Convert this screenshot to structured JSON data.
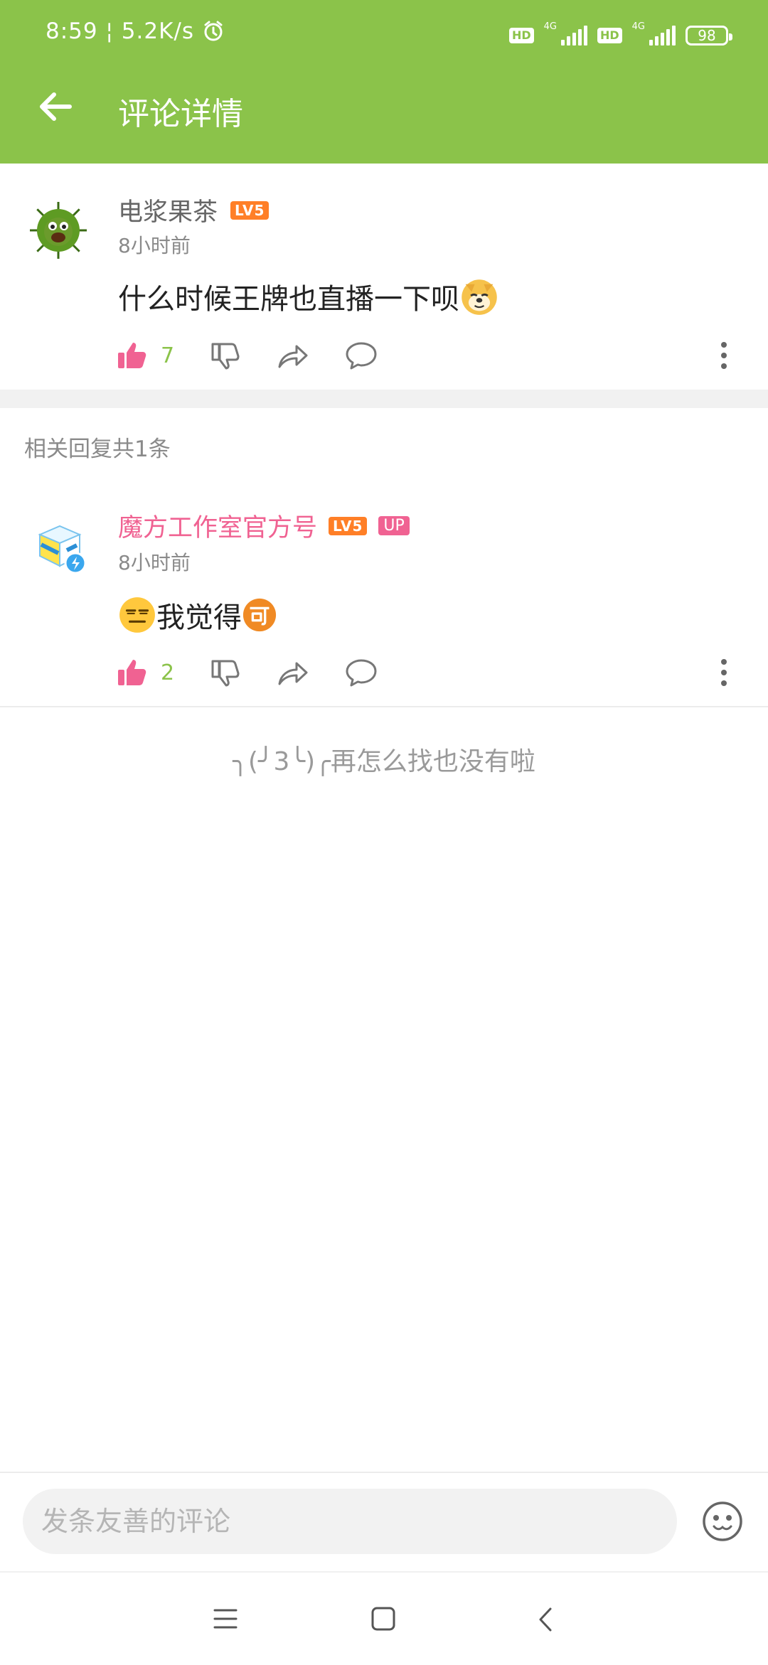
{
  "status_bar": {
    "time": "8:59",
    "speed": "5.2K/s",
    "hd": "HD",
    "network": "4G",
    "battery": "98"
  },
  "app_bar": {
    "title": "评论详情"
  },
  "main_comment": {
    "username": "电浆果茶",
    "level": "LV5",
    "time": "8小时前",
    "text": "什么时候王牌也直播一下呗",
    "likes": "7"
  },
  "replies": {
    "header": "相关回复共1条",
    "items": [
      {
        "username": "魔方工作室官方号",
        "level": "LV5",
        "badge": "UP",
        "time": "8小时前",
        "text": "我觉得",
        "likes": "2"
      }
    ]
  },
  "end_note": "╮(╯3╰)╭再怎么找也没有啦",
  "input": {
    "placeholder": "发条友善的评论"
  },
  "colors": {
    "accent": "#8BC34A",
    "like": "#F06292",
    "level": "#FF7F27",
    "up_name": "#F06292"
  },
  "icons": [
    "back-arrow-icon",
    "thumbs-up-icon",
    "thumbs-down-icon",
    "share-icon",
    "comment-icon",
    "more-vertical-icon",
    "emoji-face-icon",
    "menu-icon",
    "home-icon",
    "back-nav-icon",
    "alarm-icon"
  ]
}
